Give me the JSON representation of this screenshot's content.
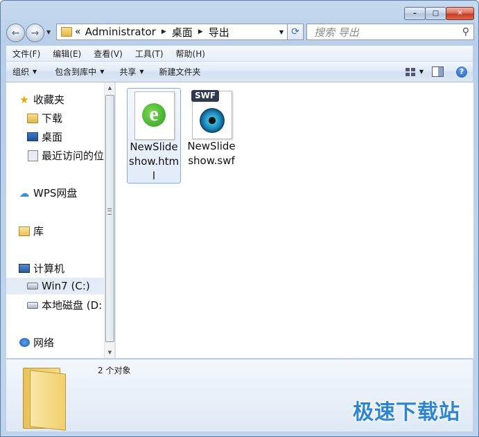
{
  "window": {
    "caption": {
      "minimize": "–",
      "maximize": "□",
      "close": "✕"
    }
  },
  "nav": {
    "back_glyph": "←",
    "forward_glyph": "→",
    "address": {
      "prefix": "«",
      "crumbs": [
        "Administrator",
        "桌面",
        "导出"
      ]
    },
    "refresh_glyph": "⟳",
    "search_placeholder": "搜索 导出"
  },
  "menubar": {
    "items": [
      "文件(F)",
      "编辑(E)",
      "查看(V)",
      "工具(T)",
      "帮助(H)"
    ]
  },
  "toolbar": {
    "organize": "组织",
    "include_in_library": "包含到库中",
    "share": "共享",
    "new_folder": "新建文件夹",
    "help_glyph": "?"
  },
  "sidebar": {
    "favorites": "收藏夹",
    "downloads": "下载",
    "desktop": "桌面",
    "recent": "最近访问的位",
    "wps": "WPS网盘",
    "library": "库",
    "computer": "计算机",
    "win7": "Win7 (C:)",
    "local_disk": "本地磁盘 (D:",
    "network": "网络"
  },
  "files": [
    {
      "name": "NewSlideshow.html",
      "icon": "ie-html-icon",
      "selected": true
    },
    {
      "name": "NewSlideshow.swf",
      "icon": "swf-icon",
      "selected": false
    }
  ],
  "file_labels": {
    "swf_tag": "SWF",
    "ie_glyph": "e"
  },
  "details": {
    "count": "2 个对象"
  },
  "watermark": "极速下载站",
  "colors": {
    "accent": "#2f86d0",
    "selection": "#e4ecf7"
  }
}
